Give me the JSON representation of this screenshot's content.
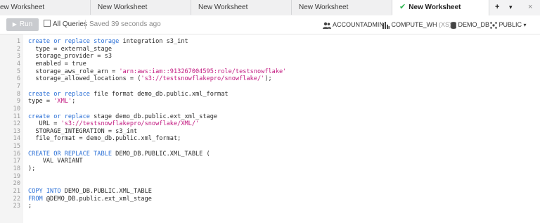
{
  "tabs": [
    {
      "label": "ew Worksheet",
      "active": false
    },
    {
      "label": "New Worksheet",
      "active": false
    },
    {
      "label": "New Worksheet",
      "active": false
    },
    {
      "label": "New Worksheet",
      "active": false
    },
    {
      "label": "New Worksheet",
      "active": true
    }
  ],
  "tab_actions": {
    "add": "+",
    "menu": "▾",
    "close": "×"
  },
  "toolbar": {
    "run_label": "Run",
    "all_queries_label": "All Queries",
    "saved_text": "Saved 39 seconds ago",
    "role": "ACCOUNTADMIN",
    "warehouse": "COMPUTE_WH",
    "warehouse_size": "(XS)",
    "database": "DEMO_DB",
    "schema": "PUBLIC"
  },
  "colors": {
    "keyword": "#2a6fd6",
    "string": "#c2187f",
    "check": "#2bb24c",
    "run_button": "#c9cbcf"
  },
  "editor": {
    "lines": [
      [
        {
          "t": "kw",
          "v": "create or replace storage"
        },
        {
          "t": "tx",
          "v": " integration s3_int"
        }
      ],
      [
        {
          "t": "tx",
          "v": "  type = external_stage"
        }
      ],
      [
        {
          "t": "tx",
          "v": "  storage_provider = s3"
        }
      ],
      [
        {
          "t": "tx",
          "v": "  enabled = true"
        }
      ],
      [
        {
          "t": "tx",
          "v": "  storage_aws_role_arn = "
        },
        {
          "t": "str",
          "v": "'arn:aws:iam::913267004595:role/testsnowflake'"
        }
      ],
      [
        {
          "t": "tx",
          "v": "  storage_allowed_locations = ("
        },
        {
          "t": "str",
          "v": "'s3://testsnowflakepro/snowflake/'"
        },
        {
          "t": "tx",
          "v": ");"
        }
      ],
      [],
      [
        {
          "t": "kw",
          "v": "create or replace"
        },
        {
          "t": "tx",
          "v": " file format demo_db.public.xml_format"
        }
      ],
      [
        {
          "t": "tx",
          "v": "type = "
        },
        {
          "t": "str",
          "v": "'XML'"
        },
        {
          "t": "tx",
          "v": ";"
        }
      ],
      [],
      [
        {
          "t": "kw",
          "v": "create or replace"
        },
        {
          "t": "tx",
          "v": " stage demo_db.public.ext_xml_stage"
        }
      ],
      [
        {
          "t": "tx",
          "v": "   URL = "
        },
        {
          "t": "str",
          "v": "'s3://testsnowflakepro/snowflake/XML/'"
        }
      ],
      [
        {
          "t": "tx",
          "v": "  STORAGE_INTEGRATION = s3_int"
        }
      ],
      [
        {
          "t": "tx",
          "v": "  file_format = demo_db.public.xml_format;"
        }
      ],
      [],
      [
        {
          "t": "kw",
          "v": "CREATE OR REPLACE TABLE"
        },
        {
          "t": "tx",
          "v": " DEMO_DB.PUBLIC.XML_TABLE ("
        }
      ],
      [
        {
          "t": "tx",
          "v": "    VAL VARIANT"
        }
      ],
      [
        {
          "t": "tx",
          "v": ");"
        }
      ],
      [],
      [],
      [
        {
          "t": "kw",
          "v": "COPY INTO"
        },
        {
          "t": "tx",
          "v": " DEMO_DB.PUBLIC.XML_TABLE"
        }
      ],
      [
        {
          "t": "kw",
          "v": "FROM"
        },
        {
          "t": "tx",
          "v": " @DEMO_DB.public.ext_xml_stage"
        }
      ],
      [
        {
          "t": "tx",
          "v": ";"
        }
      ]
    ]
  }
}
